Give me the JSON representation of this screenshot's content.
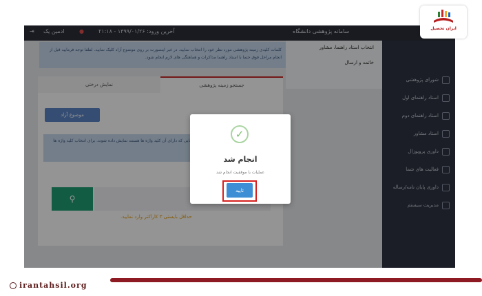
{
  "topbar": {
    "user": "ادمین یک",
    "login_date": "آخرین ورود: ۱۳۹۹/۰۱/۲۶ - ۲۱:۱۸",
    "org_title": "سامانه پژوهشی دانشگاه"
  },
  "sidebar": {
    "items": [
      {
        "label": "شورای پژوهشی"
      },
      {
        "label": "استاد راهنمای اول"
      },
      {
        "label": "استاد راهنمای دوم"
      },
      {
        "label": "استاد مشاور"
      },
      {
        "label": "داوری پروپوزال"
      },
      {
        "label": "فعالیت های شما"
      },
      {
        "label": "داوری پایان نامه/رساله"
      },
      {
        "label": "مدیریت سیستم"
      }
    ]
  },
  "right_list": {
    "item1": "انتخاب استاد راهنما، مشاور",
    "item2": "خاتمه و ارسال"
  },
  "notice": {
    "text": "کلمات کلیدی زمینه پژوهشی مورد نظر خود را انتخاب نمایید. در غیر اینصورت بر روی موضوع آزاد کلیک نمایید. لطفا توجه فرمایید قبل از انجام مراحل فوق حتما با استاد راهنما مذاکرات و هماهنگی های لازم انجام شود."
  },
  "tabs": {
    "search": "جستجو زمینه پژوهشی",
    "tree": "نمایش درختی"
  },
  "panel": {
    "free_topic_button": "موضوع آزاد",
    "info_text": "اگر از کاراکتر \"*\" در هر جدا کنید تا تمام زمینه هایی که دارای آن کلید واژه ها هستند نمایش داده شوند. برای انتخاب کلید واژه ها باید گزینه \"و\" را انتخاب کنید.",
    "hint": "حداقل بایستی ۳ کاراکتر وارد نمایید."
  },
  "modal": {
    "title": "انجام شد",
    "message": "عملیات با موفقیت انجام شد",
    "ok_label": "تایید"
  },
  "brand": {
    "logo_text": "ایران تحصیل",
    "site": "irantahsil.org"
  },
  "colors": {
    "topbar": "#2b2f3a",
    "sidebar": "#2f3442",
    "accent_blue": "#3e8ed6",
    "search_green": "#1f9f74",
    "highlight_red": "#d61f1f",
    "brand_red": "#8e1b24"
  }
}
